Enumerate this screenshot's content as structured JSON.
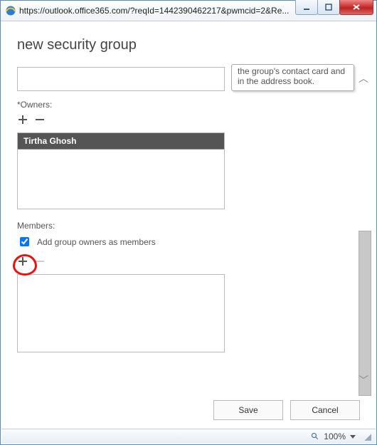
{
  "titlebar": {
    "url": "https://outlook.office365.com/?reqId=1442390462217&pwmcid=2&Re..."
  },
  "page": {
    "title": "new security group"
  },
  "tooltip": {
    "text": "the group's contact card and in the address book."
  },
  "owners": {
    "label": "*Owners:",
    "items": [
      "Tirtha Ghosh"
    ]
  },
  "members": {
    "label": "Members:",
    "checkbox_label": "Add group owners as members",
    "checkbox_checked": true
  },
  "buttons": {
    "save": "Save",
    "cancel": "Cancel"
  },
  "status": {
    "zoom": "100%"
  }
}
